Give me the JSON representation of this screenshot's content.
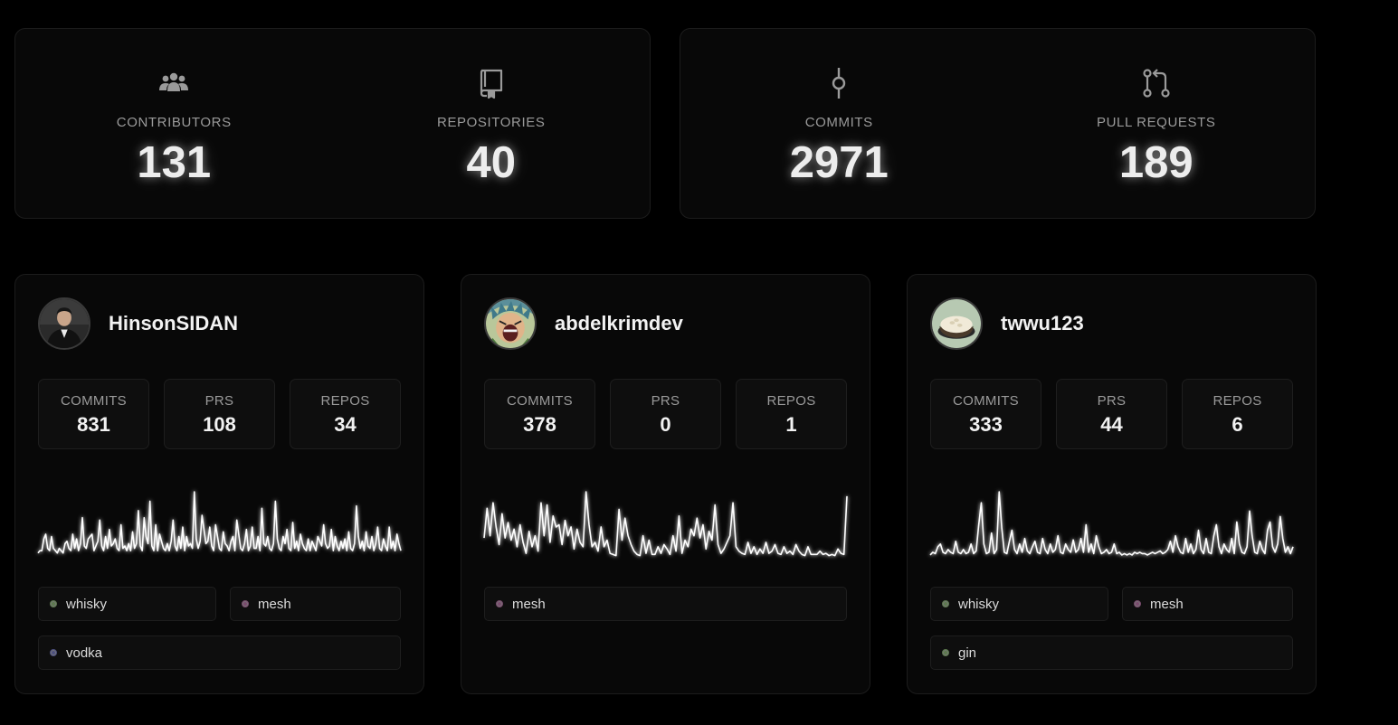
{
  "summary": {
    "left": [
      {
        "label": "CONTRIBUTORS",
        "value": "131",
        "icon": "users-icon"
      },
      {
        "label": "REPOSITORIES",
        "value": "40",
        "icon": "repo-icon"
      }
    ],
    "right": [
      {
        "label": "COMMITS",
        "value": "2971",
        "icon": "commit-icon"
      },
      {
        "label": "PULL REQUESTS",
        "value": "189",
        "icon": "pull-request-icon"
      }
    ]
  },
  "users": [
    {
      "name": "HinsonSIDAN",
      "stats": [
        {
          "label": "COMMITS",
          "value": "831"
        },
        {
          "label": "PRS",
          "value": "108"
        },
        {
          "label": "REPOS",
          "value": "34"
        }
      ],
      "activity": [
        2,
        3,
        3,
        8,
        10,
        4,
        3,
        9,
        4,
        3,
        2,
        4,
        3,
        2,
        6,
        7,
        4,
        3,
        10,
        4,
        8,
        3,
        6,
        17,
        5,
        4,
        8,
        9,
        10,
        3,
        5,
        7,
        16,
        5,
        3,
        9,
        4,
        12,
        5,
        6,
        8,
        4,
        3,
        14,
        4,
        5,
        3,
        6,
        3,
        11,
        4,
        6,
        20,
        5,
        3,
        17,
        9,
        6,
        24,
        5,
        3,
        14,
        3,
        10,
        7,
        4,
        3,
        6,
        3,
        7,
        16,
        5,
        3,
        9,
        4,
        13,
        3,
        9,
        5,
        6,
        4,
        28,
        8,
        4,
        7,
        18,
        12,
        6,
        7,
        13,
        5,
        3,
        14,
        9,
        4,
        3,
        11,
        6,
        5,
        3,
        7,
        9,
        3,
        16,
        10,
        4,
        3,
        6,
        12,
        3,
        5,
        13,
        4,
        4,
        9,
        3,
        21,
        6,
        5,
        9,
        4,
        3,
        6,
        24,
        8,
        4,
        3,
        9,
        6,
        12,
        4,
        3,
        15,
        4,
        7,
        3,
        10,
        6,
        4,
        3,
        8,
        3,
        7,
        5,
        3,
        9,
        7,
        5,
        14,
        6,
        4,
        5,
        12,
        3,
        9,
        5,
        3,
        7,
        4,
        8,
        3,
        11,
        4,
        3,
        6,
        22,
        9,
        4,
        7,
        3,
        11,
        5,
        4,
        9,
        3,
        6,
        13,
        4,
        3,
        8,
        5,
        3,
        13,
        4,
        7,
        3,
        10,
        6,
        3
      ],
      "peaks_note": "",
      "tags": [
        {
          "name": "whisky",
          "color": "#5d7a4e"
        },
        {
          "name": "mesh",
          "color": "#7a4a6e"
        },
        {
          "name": "vodka",
          "color": "#4e5180"
        }
      ]
    },
    {
      "name": "abdelkrimdev",
      "stats": [
        {
          "label": "COMMITS",
          "value": "378"
        },
        {
          "label": "PRS",
          "value": "0"
        },
        {
          "label": "REPOS",
          "value": "1"
        }
      ],
      "activity": [
        18,
        45,
        20,
        50,
        28,
        12,
        40,
        18,
        32,
        16,
        26,
        10,
        30,
        14,
        4,
        24,
        10,
        20,
        6,
        50,
        20,
        48,
        14,
        38,
        28,
        30,
        12,
        34,
        20,
        28,
        8,
        26,
        14,
        10,
        60,
        30,
        10,
        14,
        6,
        28,
        10,
        16,
        4,
        3,
        2,
        44,
        16,
        36,
        20,
        12,
        6,
        3,
        2,
        20,
        4,
        16,
        3,
        3,
        10,
        4,
        12,
        8,
        3,
        20,
        6,
        38,
        4,
        16,
        10,
        26,
        20,
        36,
        18,
        30,
        8,
        24,
        16,
        48,
        12,
        4,
        8,
        14,
        20,
        50,
        10,
        6,
        4,
        3,
        14,
        4,
        10,
        3,
        8,
        4,
        14,
        4,
        6,
        12,
        4,
        3,
        10,
        4,
        6,
        3,
        12,
        6,
        3,
        2,
        10,
        3,
        3,
        3,
        6,
        3,
        4,
        2,
        3,
        2,
        8,
        4,
        3,
        56
      ],
      "peaks_note": "",
      "tags": [
        {
          "name": "mesh",
          "color": "#7a4a6e"
        }
      ]
    },
    {
      "name": "twwu123",
      "stats": [
        {
          "label": "COMMITS",
          "value": "333"
        },
        {
          "label": "PRS",
          "value": "44"
        },
        {
          "label": "REPOS",
          "value": "6"
        }
      ],
      "activity": [
        2,
        4,
        3,
        8,
        10,
        4,
        3,
        6,
        4,
        3,
        12,
        4,
        3,
        6,
        3,
        4,
        10,
        3,
        5,
        24,
        40,
        10,
        3,
        4,
        18,
        3,
        6,
        48,
        22,
        4,
        3,
        12,
        20,
        6,
        3,
        10,
        4,
        14,
        5,
        3,
        8,
        12,
        4,
        3,
        14,
        6,
        3,
        10,
        4,
        6,
        16,
        4,
        3,
        10,
        6,
        4,
        13,
        4,
        6,
        14,
        4,
        24,
        4,
        10,
        3,
        16,
        8,
        3,
        4,
        6,
        3,
        4,
        10,
        3,
        4,
        2,
        3,
        2,
        3,
        2,
        4,
        3,
        4,
        3,
        3,
        2,
        3,
        4,
        3,
        4,
        5,
        3,
        4,
        6,
        12,
        4,
        16,
        8,
        4,
        3,
        14,
        4,
        10,
        3,
        6,
        20,
        6,
        3,
        14,
        4,
        3,
        16,
        24,
        8,
        3,
        10,
        6,
        4,
        14,
        3,
        26,
        10,
        4,
        3,
        8,
        34,
        16,
        4,
        3,
        12,
        6,
        3,
        20,
        26,
        8,
        4,
        10,
        30,
        14,
        4,
        8,
        3,
        8
      ],
      "peaks_note": "",
      "tags": [
        {
          "name": "whisky",
          "color": "#5d7a4e"
        },
        {
          "name": "mesh",
          "color": "#7a4a6e"
        },
        {
          "name": "gin",
          "color": "#5d7a4e"
        }
      ]
    }
  ]
}
